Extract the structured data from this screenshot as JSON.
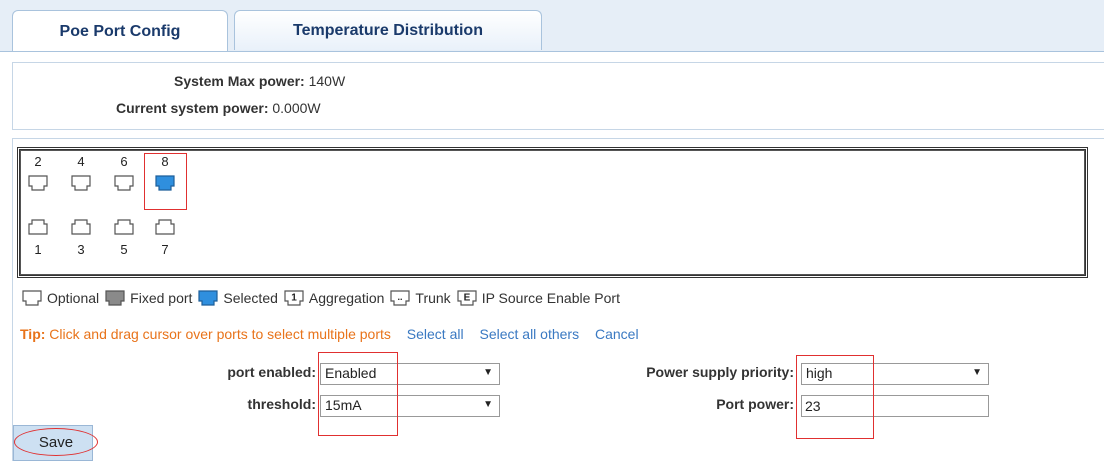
{
  "tabs": [
    {
      "label": "Poe Port Config",
      "active": true
    },
    {
      "label": "Temperature Distribution",
      "active": false
    }
  ],
  "system": {
    "max_power_label": "System Max power:",
    "max_power_value": "140W",
    "current_power_label": "Current system power:",
    "current_power_value": "0.000W"
  },
  "ports": {
    "top": [
      "2",
      "4",
      "6",
      "8"
    ],
    "bottom": [
      "1",
      "3",
      "5",
      "7"
    ],
    "selected": [
      "8"
    ]
  },
  "legend": {
    "optional": "Optional",
    "fixed": "Fixed port",
    "selected": "Selected",
    "aggregation": "Aggregation",
    "aggregation_glyph": "1",
    "trunk": "Trunk",
    "trunk_glyph": "..",
    "ipsource": "IP Source Enable Port",
    "ipsource_glyph": "E"
  },
  "tip": {
    "label": "Tip:",
    "text": "Click and drag cursor over ports to select multiple ports",
    "select_all": "Select all",
    "select_all_others": "Select all others",
    "cancel": "Cancel"
  },
  "form": {
    "port_enabled_label": "port enabled:",
    "port_enabled_value": "Enabled",
    "threshold_label": "threshold:",
    "threshold_value": "15mA",
    "priority_label": "Power supply priority:",
    "priority_value": "high",
    "port_power_label": "Port power:",
    "port_power_value": "23",
    "dropdown_arrow": "▼"
  },
  "save_label": "Save",
  "colors": {
    "accent_red": "#e03030",
    "tip_orange": "#e8731a",
    "link_blue": "#3a79c2",
    "selected_port": "#2f8fde"
  }
}
